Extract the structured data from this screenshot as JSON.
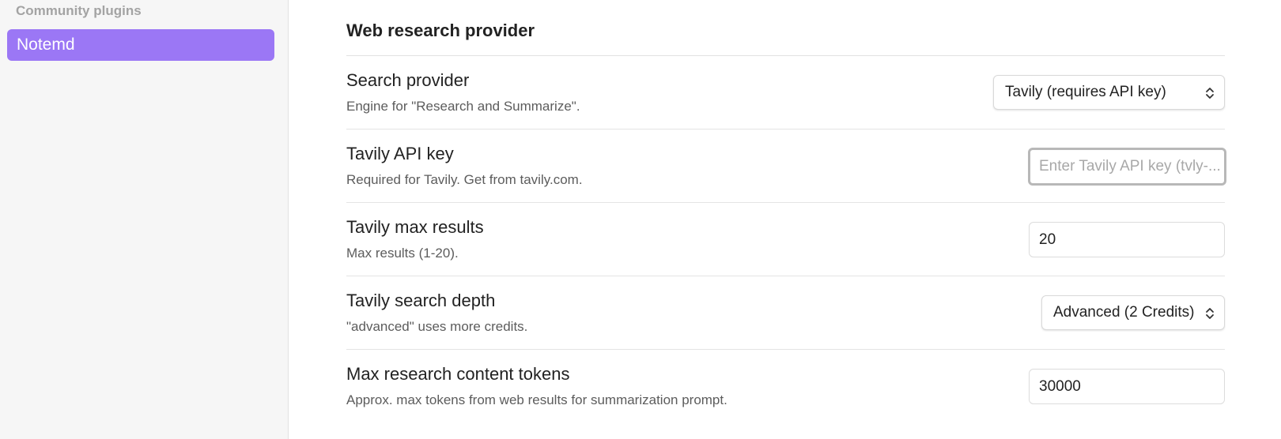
{
  "sidebar": {
    "heading": "Community plugins",
    "items": [
      {
        "label": "Notemd",
        "active": true
      }
    ]
  },
  "section": {
    "title": "Web research provider"
  },
  "settings": {
    "search_provider": {
      "name": "Search provider",
      "desc": "Engine for \"Research and Summarize\".",
      "value": "Tavily (requires API key)"
    },
    "tavily_api_key": {
      "name": "Tavily API key",
      "desc": "Required for Tavily. Get from tavily.com.",
      "value": "",
      "placeholder": "Enter Tavily API key (tvly-..."
    },
    "tavily_max_results": {
      "name": "Tavily max results",
      "desc": "Max results (1-20).",
      "value": "20"
    },
    "tavily_search_depth": {
      "name": "Tavily search depth",
      "desc": "\"advanced\" uses more credits.",
      "value": "Advanced (2 Credits)"
    },
    "max_research_tokens": {
      "name": "Max research content tokens",
      "desc": "Approx. max tokens from web results for summarization prompt.",
      "value": "30000"
    }
  },
  "colors": {
    "accent": "#9b77f5",
    "sidebar_bg": "#f6f6f6",
    "muted_text": "#5c5c5c"
  },
  "icons": {
    "dropdown": "chevron-up-down-icon"
  }
}
